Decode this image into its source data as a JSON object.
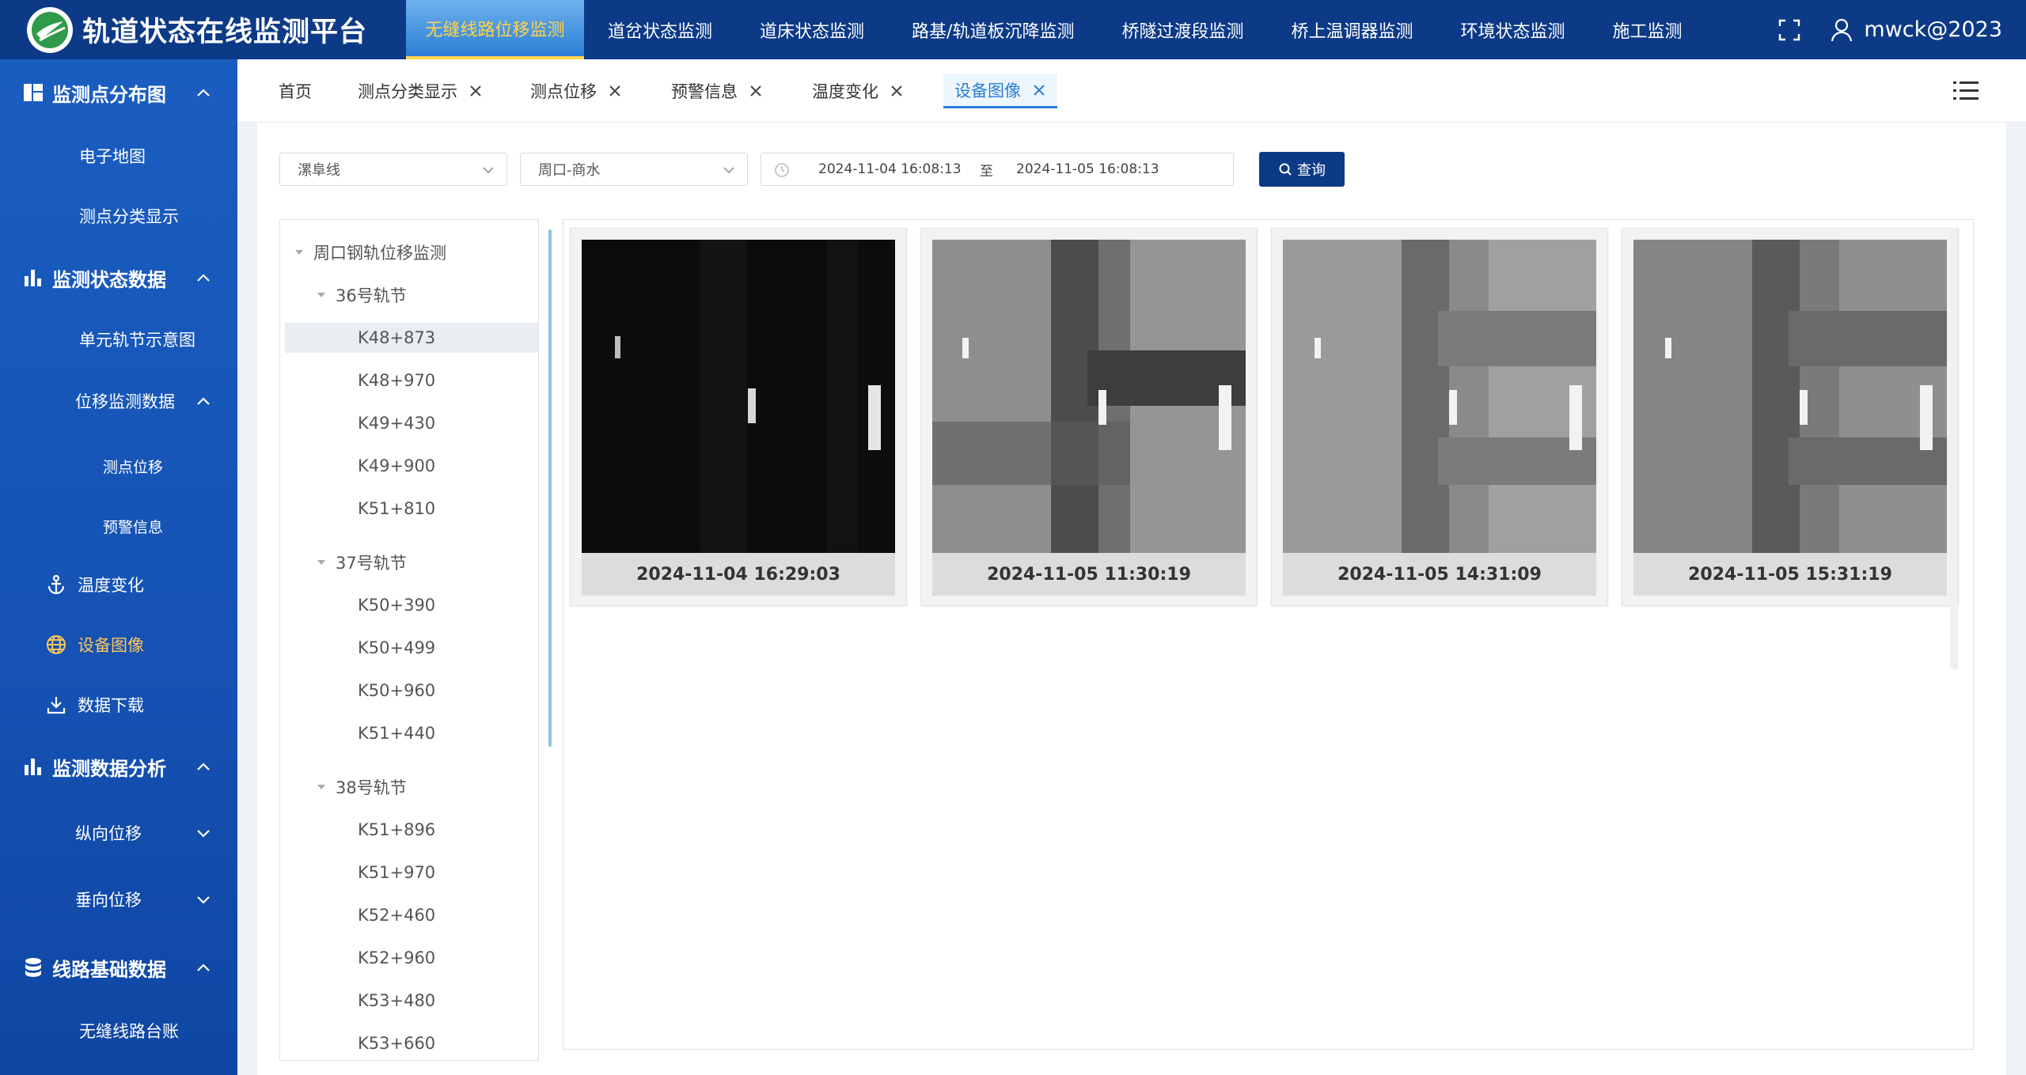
{
  "header": {
    "title": "轨道状态在线监测平台",
    "nav": [
      "无缝线路位移监测",
      "道岔状态监测",
      "道床状态监测",
      "路基/轨道板沉降监测",
      "桥隧过渡段监测",
      "桥上温调器监测",
      "环境状态监测",
      "施工监测"
    ],
    "active_nav": "无缝线路位移监测",
    "username": "mwck@2023"
  },
  "sidebar": {
    "group1": "监测点分布图",
    "g1_items": [
      "电子地图",
      "测点分类显示"
    ],
    "group2": "监测状态数据",
    "g2_items": [
      "单元轨节示意图",
      "位移监测数据"
    ],
    "g2_sub": [
      "测点位移",
      "预警信息"
    ],
    "g2_items2": [
      "温度变化",
      "设备图像",
      "数据下载"
    ],
    "group3": "监测数据分析",
    "g3_items": [
      "纵向位移",
      "垂向位移"
    ],
    "group4": "线路基础数据",
    "g4_items": [
      "无缝线路台账"
    ],
    "active_item": "设备图像"
  },
  "tabs": [
    "首页",
    "测点分类显示",
    "测点位移",
    "预警信息",
    "温度变化",
    "设备图像"
  ],
  "active_tab": "设备图像",
  "filters": {
    "line": "漯阜线",
    "section": "周口-商水",
    "date_start": "2024-11-04 16:08:13",
    "date_sep": "至",
    "date_end": "2024-11-05 16:08:13",
    "query_label": "查询"
  },
  "tree": {
    "root": "周口钢轨位移监测",
    "groups": [
      {
        "label": "36号轨节",
        "items": [
          "K48+873",
          "K48+970",
          "K49+430",
          "K49+900",
          "K51+810"
        ]
      },
      {
        "label": "37号轨节",
        "items": [
          "K50+390",
          "K50+499",
          "K50+960",
          "K51+440"
        ]
      },
      {
        "label": "38号轨节",
        "items": [
          "K51+896",
          "K51+970",
          "K52+460",
          "K52+960",
          "K53+480",
          "K53+660"
        ]
      }
    ],
    "selected": "K48+873"
  },
  "images": [
    {
      "caption": "2024-11-04 16:29:03"
    },
    {
      "caption": "2024-11-05 11:30:19"
    },
    {
      "caption": "2024-11-05 14:31:09"
    },
    {
      "caption": "2024-11-05 15:31:19"
    }
  ]
}
